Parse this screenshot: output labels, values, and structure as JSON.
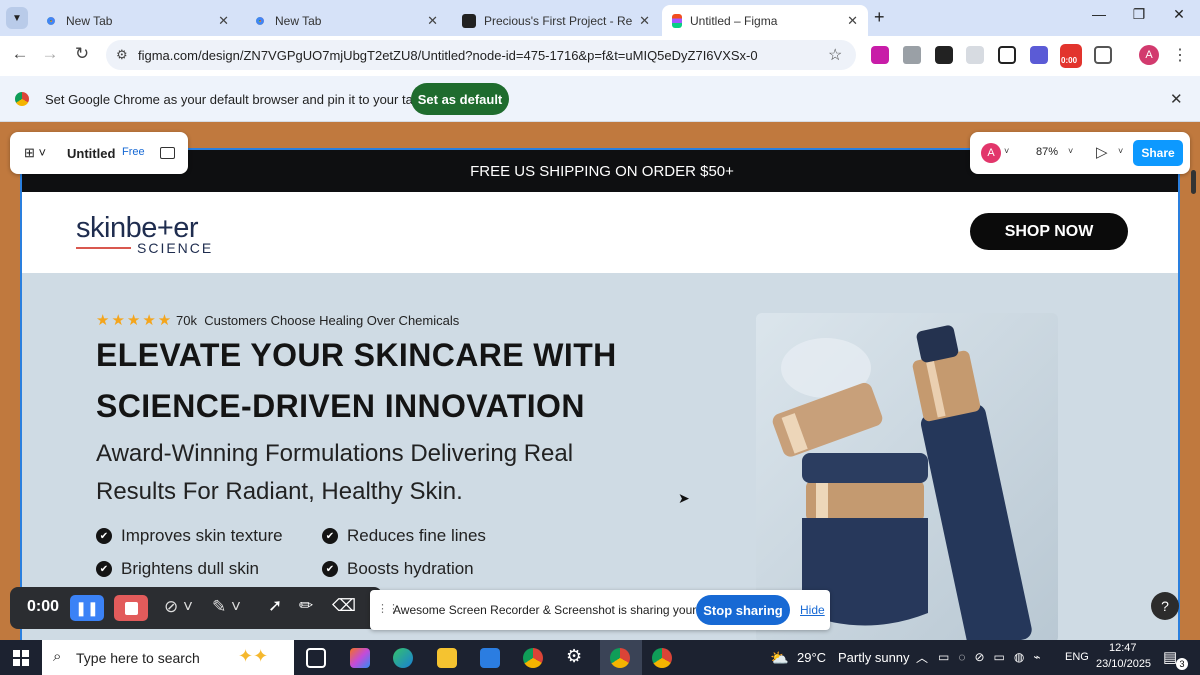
{
  "browser": {
    "tabs": [
      {
        "title": "New Tab"
      },
      {
        "title": "New Tab"
      },
      {
        "title": "Precious's First Project - Replo"
      },
      {
        "title": "Untitled – Figma"
      }
    ],
    "url": "figma.com/design/ZN7VGPgUO7mjUbgT2etZU8/Untitled?node-id=475-1716&p=f&t=uMIQ5eDyZ7I6VXSx-0",
    "profile_initial": "A",
    "ext_badge": "0:00",
    "infobar": {
      "message": "Set Google Chrome as your default browser and pin it to your taskbar",
      "button": "Set as default"
    }
  },
  "figma": {
    "file_name": "Untitled",
    "plan_badge": "Free",
    "avatar": "A",
    "zoom": "87%",
    "share_label": "Share",
    "help": "?"
  },
  "page": {
    "shipping": "FREE US SHIPPING ON ORDER $50+",
    "logo_main": "skinbe+er",
    "logo_sub": "SCIENCE",
    "cta": "SHOP NOW",
    "rating_count": "70k",
    "rating_text": "Customers Choose Healing Over Chemicals",
    "headline_1": "ELEVATE YOUR SKINCARE WITH",
    "headline_2": "SCIENCE-DRIVEN INNOVATION",
    "subhead_1": "Award-Winning Formulations Delivering Real",
    "subhead_2": "Results For Radiant, Healthy Skin.",
    "features": [
      "Improves skin texture",
      "Reduces fine lines",
      "Brightens dull skin",
      "Boosts hydration"
    ],
    "rating_stars": 5
  },
  "recorder": {
    "timer": "0:00",
    "share_message": "Awesome Screen Recorder & Screenshot is sharing your screen.",
    "stop_label": "Stop sharing",
    "hide_label": "Hide"
  },
  "taskbar": {
    "search_placeholder": "Type here to search",
    "weather_temp": "29°C",
    "weather_text": "Partly sunny",
    "lang": "ENG",
    "time": "12:47",
    "date": "23/10/2025",
    "notif_count": "3"
  },
  "colors": {
    "tab_strip": "#d6e2f8",
    "canvas_bg": "#c0793e",
    "brand_navy": "#1f2d4f",
    "selection_blue": "#2a7fde",
    "share_button": "#1769d4"
  }
}
